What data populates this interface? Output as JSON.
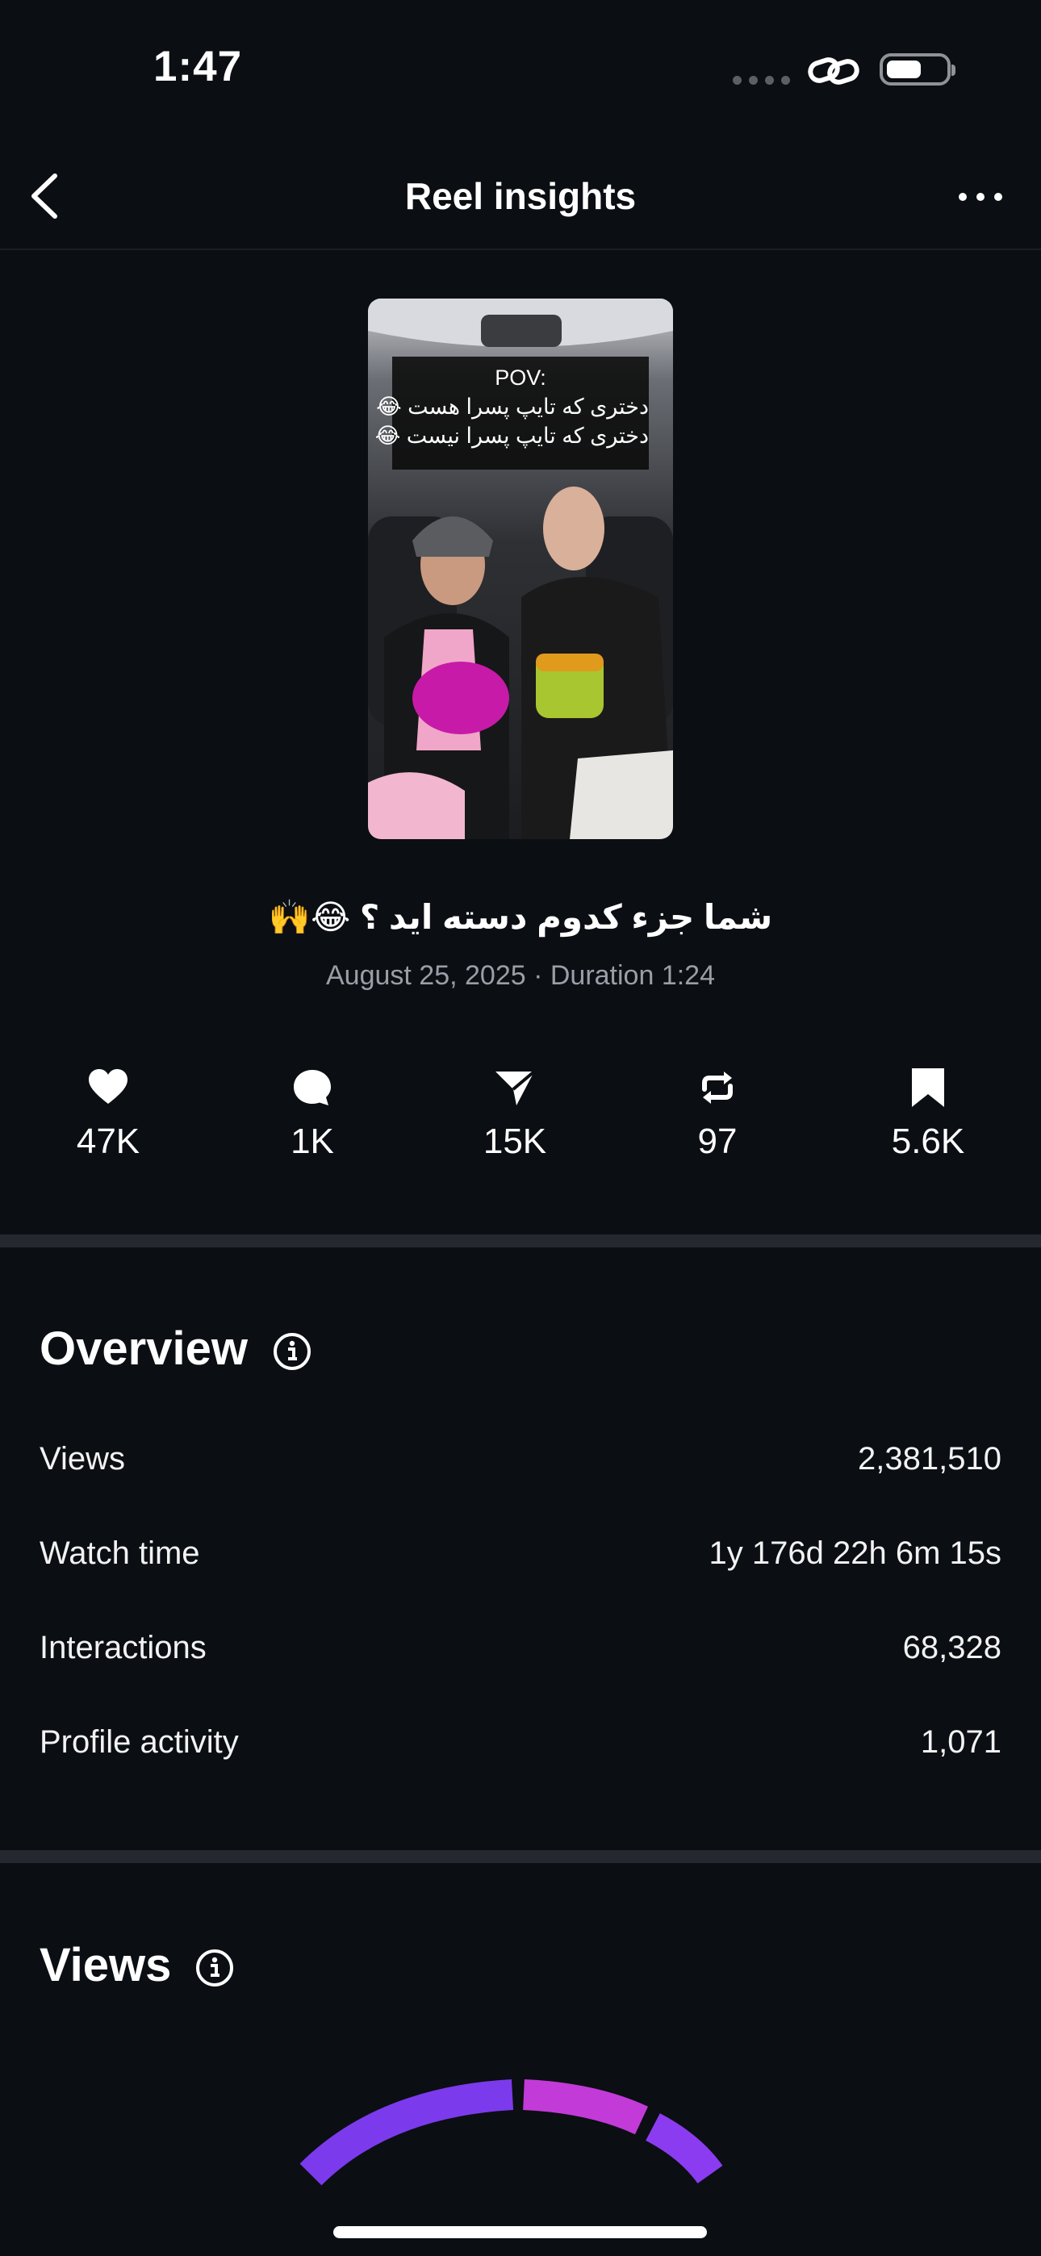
{
  "status_bar": {
    "time": "1:47"
  },
  "nav": {
    "title": "Reel insights",
    "back_icon": "chevron-left-icon",
    "more_icon": "ellipsis-icon"
  },
  "reel": {
    "overlay_lines": [
      "POV:",
      "دختری که تایپ پسرا هست 😂",
      "دختری که تایپ پسرا نیست 😂"
    ],
    "caption": "شما جزء کدوم دسته اید ؟ 😂🙌",
    "meta": "August 25, 2025 · Duration 1:24"
  },
  "stats": [
    {
      "icon": "heart-icon",
      "value": "47K"
    },
    {
      "icon": "comment-icon",
      "value": "1K"
    },
    {
      "icon": "send-icon",
      "value": "15K"
    },
    {
      "icon": "repost-icon",
      "value": "97"
    },
    {
      "icon": "bookmark-icon",
      "value": "5.6K"
    }
  ],
  "overview": {
    "title": "Overview",
    "rows": [
      {
        "label": "Views",
        "value": "2,381,510"
      },
      {
        "label": "Watch time",
        "value": "1y 176d 22h 6m 15s"
      },
      {
        "label": "Interactions",
        "value": "68,328"
      },
      {
        "label": "Profile activity",
        "value": "1,071"
      }
    ]
  },
  "views_section": {
    "title": "Views",
    "gauge_colors": [
      "#7c3aed",
      "#c23ad8",
      "#8b3cf0"
    ]
  },
  "colors": {
    "background": "#0b0e13",
    "divider": "#25282e",
    "muted_text": "#9a9ea6"
  }
}
